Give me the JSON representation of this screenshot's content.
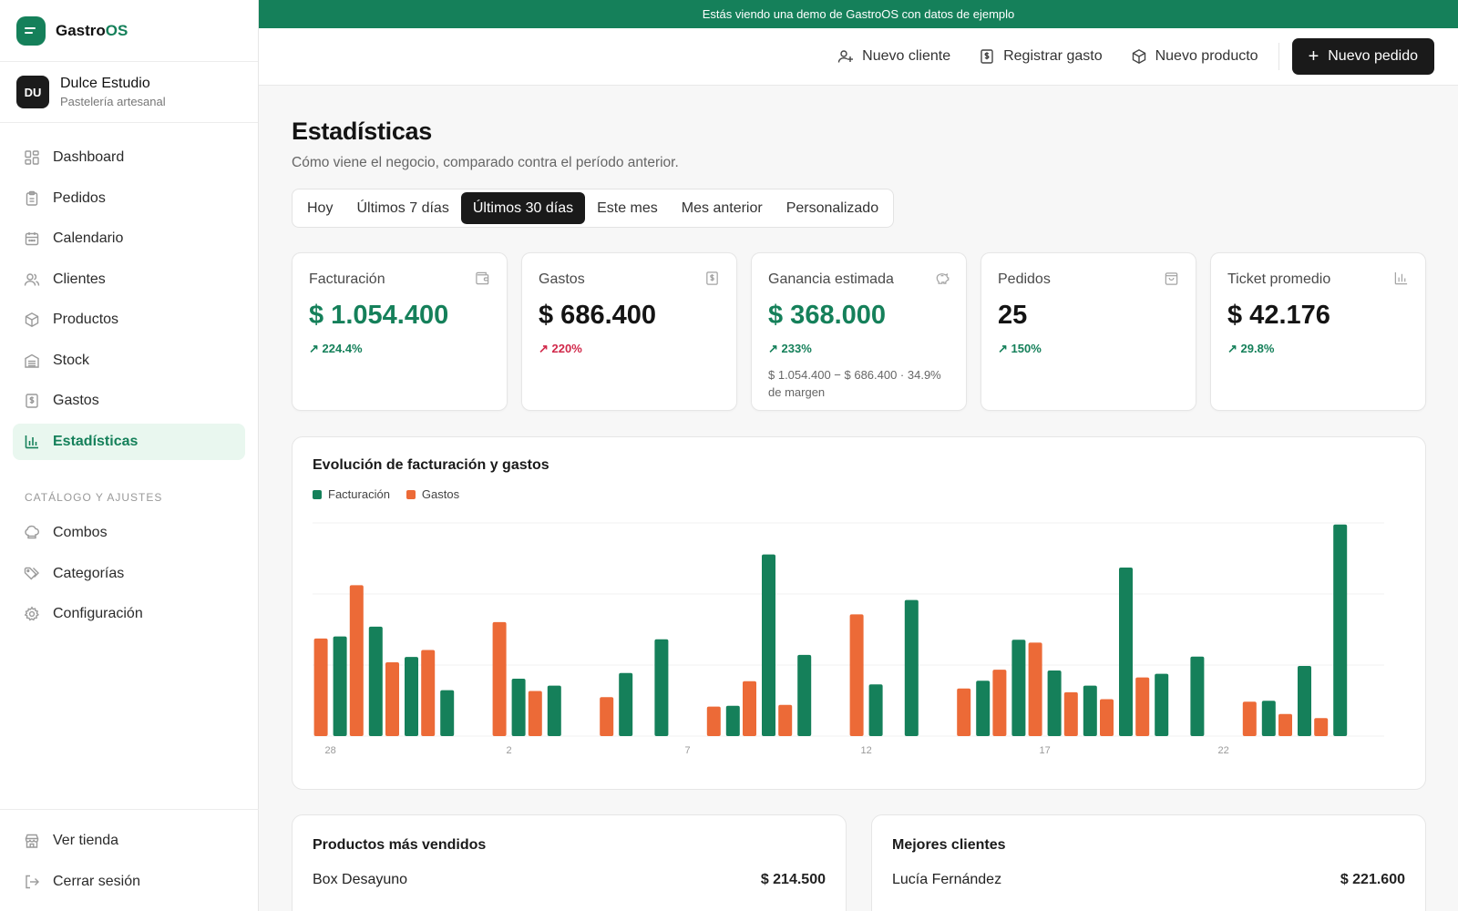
{
  "banner": {
    "text": "Estás viendo una demo de GastroOS con datos de ejemplo"
  },
  "brand": {
    "name_a": "Gastro",
    "name_b": "OS"
  },
  "store": {
    "initials": "DU",
    "name": "Dulce Estudio",
    "subtitle": "Pastelería artesanal"
  },
  "sidebar": {
    "items": [
      {
        "label": "Dashboard",
        "icon": "grid-icon"
      },
      {
        "label": "Pedidos",
        "icon": "clipboard-icon"
      },
      {
        "label": "Calendario",
        "icon": "calendar-icon"
      },
      {
        "label": "Clientes",
        "icon": "users-icon"
      },
      {
        "label": "Productos",
        "icon": "box-icon"
      },
      {
        "label": "Stock",
        "icon": "stock-icon"
      },
      {
        "label": "Gastos",
        "icon": "receipt-icon"
      },
      {
        "label": "Estadísticas",
        "icon": "bar-chart-icon",
        "active": true
      }
    ],
    "section_title": "CATÁLOGO Y AJUSTES",
    "section_items": [
      {
        "label": "Combos",
        "icon": "chef-hat-icon"
      },
      {
        "label": "Categorías",
        "icon": "tags-icon"
      },
      {
        "label": "Configuración",
        "icon": "gear-icon"
      }
    ],
    "bottom_items": [
      {
        "label": "Ver tienda",
        "icon": "store-icon"
      },
      {
        "label": "Cerrar sesión",
        "icon": "logout-icon"
      }
    ]
  },
  "toolbar": {
    "new_client": "Nuevo cliente",
    "register_expense": "Registrar gasto",
    "new_product": "Nuevo producto",
    "new_order": "Nuevo pedido"
  },
  "page": {
    "title": "Estadísticas",
    "subtitle": "Cómo viene el negocio, comparado contra el período anterior."
  },
  "range_tabs": [
    {
      "label": "Hoy"
    },
    {
      "label": "Últimos 7 días"
    },
    {
      "label": "Últimos 30 días",
      "active": true
    },
    {
      "label": "Este mes"
    },
    {
      "label": "Mes anterior"
    },
    {
      "label": "Personalizado"
    }
  ],
  "kpis": [
    {
      "label": "Facturación",
      "value": "$ 1.054.400",
      "change": "224.4%",
      "trend": "up",
      "icon": "wallet-icon",
      "value_color": "green"
    },
    {
      "label": "Gastos",
      "value": "$ 686.400",
      "change": "220%",
      "trend": "up-bad",
      "icon": "receipt-icon",
      "value_color": "dark"
    },
    {
      "label": "Ganancia estimada",
      "value": "$ 368.000",
      "change": "233%",
      "trend": "up",
      "icon": "piggy-bank-icon",
      "value_color": "green",
      "note": "$ 1.054.400 − $ 686.400 · 34.9% de margen"
    },
    {
      "label": "Pedidos",
      "value": "25",
      "change": "150%",
      "trend": "up",
      "icon": "shopping-bag-icon",
      "value_color": "dark"
    },
    {
      "label": "Ticket promedio",
      "value": "$ 42.176",
      "change": "29.8%",
      "trend": "up",
      "icon": "bar-chart-icon",
      "value_color": "dark"
    }
  ],
  "chart_card": {
    "title": "Evolución de facturación y gastos"
  },
  "chart_data": {
    "type": "bar",
    "categories": [
      "28",
      "29",
      "30",
      "31",
      "1",
      "2",
      "3",
      "4",
      "5",
      "6",
      "7",
      "8",
      "9",
      "10",
      "11",
      "12",
      "13",
      "14",
      "15",
      "16",
      "17",
      "18",
      "19",
      "20",
      "21",
      "22",
      "23",
      "24",
      "25",
      "26"
    ],
    "tick_labels": [
      "28",
      "2",
      "7",
      "12",
      "17",
      "22"
    ],
    "series": [
      {
        "name": "Facturación",
        "color": "#15805a",
        "values": [
          24300,
          26700,
          19300,
          11200,
          0,
          14000,
          12300,
          0,
          15400,
          23600,
          0,
          7400,
          44300,
          19800,
          0,
          12600,
          33200,
          0,
          13500,
          23500,
          16000,
          12300,
          41100,
          15200,
          19400,
          0,
          8600,
          17100,
          51600,
          0
        ]
      },
      {
        "name": "Gastos",
        "color": "#ec6a37",
        "values": [
          23800,
          36800,
          18000,
          21000,
          0,
          27800,
          11000,
          0,
          9500,
          0,
          0,
          7200,
          13400,
          7600,
          0,
          29700,
          0,
          0,
          11600,
          16200,
          22800,
          10700,
          9000,
          14300,
          0,
          0,
          8400,
          5400,
          4400,
          0
        ]
      }
    ],
    "ylim": [
      0,
      52000
    ],
    "grid": true,
    "legend": "top-left"
  },
  "top_products": {
    "title": "Productos más vendidos",
    "rows": [
      {
        "name": "Box Desayuno",
        "amount": "$ 214.500"
      }
    ]
  },
  "top_clients": {
    "title": "Mejores clientes",
    "rows": [
      {
        "name": "Lucía Fernández",
        "amount": "$ 221.600"
      }
    ]
  }
}
